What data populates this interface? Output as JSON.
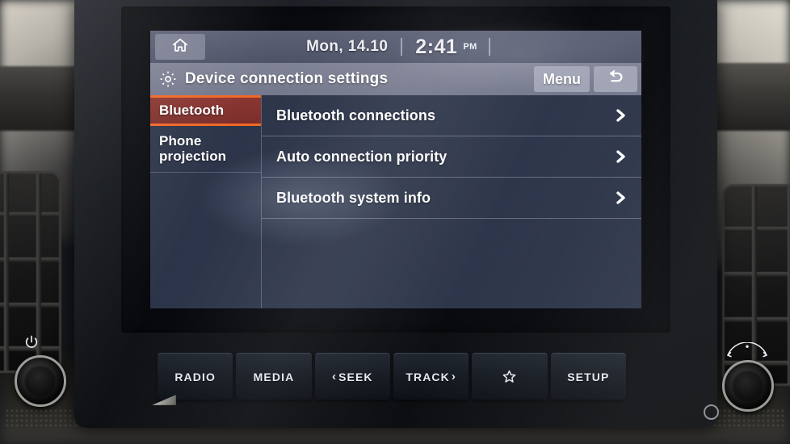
{
  "status_bar": {
    "home_icon": "home-icon",
    "date": "Mon, 14.10",
    "time": "2:41",
    "ampm": "PM"
  },
  "title_bar": {
    "icon": "gear-icon",
    "title": "Device connection settings",
    "menu_label": "Menu",
    "back_icon": "back-arrow-icon"
  },
  "sidebar": {
    "items": [
      {
        "label": "Bluetooth",
        "active": true
      },
      {
        "label": "Phone projection",
        "active": false
      }
    ]
  },
  "list": {
    "rows": [
      {
        "label": "Bluetooth connections",
        "chevron": "chevron-right-icon"
      },
      {
        "label": "Auto connection priority",
        "chevron": "chevron-right-icon"
      },
      {
        "label": "Bluetooth system info",
        "chevron": "chevron-right-icon"
      }
    ]
  },
  "hardware_buttons": [
    {
      "label": "RADIO",
      "icon": null,
      "prefix": null,
      "suffix": null
    },
    {
      "label": "MEDIA",
      "icon": null,
      "prefix": null,
      "suffix": null
    },
    {
      "label": "SEEK",
      "icon": null,
      "prefix": "‹",
      "suffix": null
    },
    {
      "label": "TRACK",
      "icon": null,
      "prefix": null,
      "suffix": "›"
    },
    {
      "label": "",
      "icon": "star-icon",
      "prefix": null,
      "suffix": null
    },
    {
      "label": "SETUP",
      "icon": null,
      "prefix": null,
      "suffix": null
    }
  ],
  "knobs": {
    "left": {
      "name": "power-volume-knob",
      "icon": "power-icon"
    },
    "right": {
      "name": "tune-knob",
      "icon": "tune-arc-icon"
    }
  },
  "colors": {
    "accent_orange": "#f26524",
    "active_tab_red": "#8a3430",
    "screen_bg": "#2b3348",
    "status_bar": "#525769",
    "title_bar": "#787c90",
    "text_white": "#ffffff"
  }
}
